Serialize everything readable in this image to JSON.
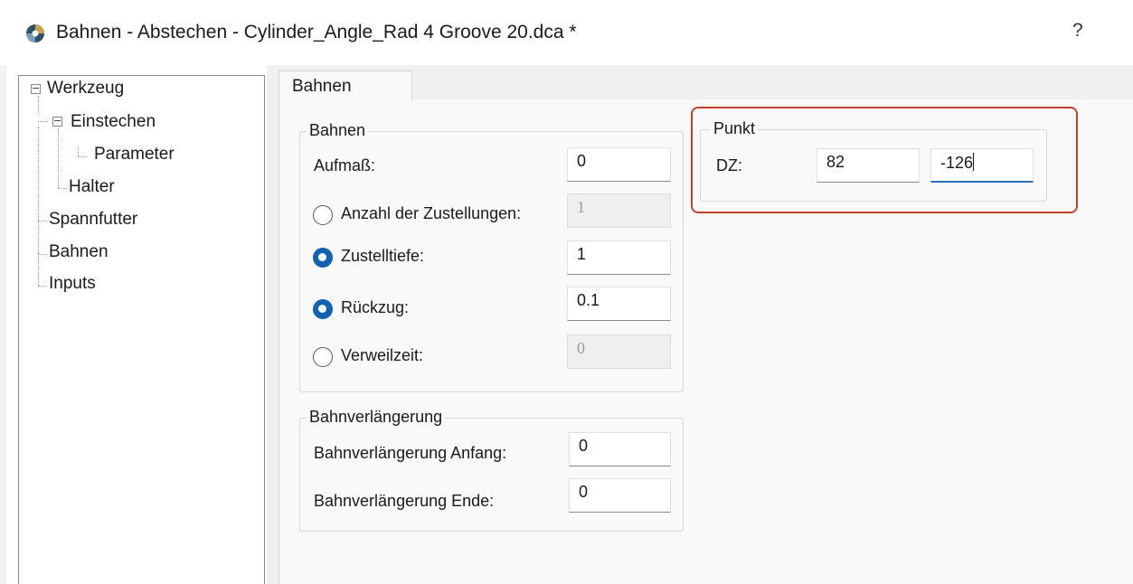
{
  "window": {
    "title": "Bahnen - Abstechen - Cylinder_Angle_Rad 4 Groove 20.dca *",
    "help_label": "?",
    "app_icon": "gear-app-icon"
  },
  "tree": {
    "items": [
      {
        "label": "Werkzeug",
        "expanded": true
      },
      {
        "label": "Einstechen",
        "expanded": true
      },
      {
        "label": "Parameter"
      },
      {
        "label": "Halter"
      },
      {
        "label": "Spannfutter"
      },
      {
        "label": "Bahnen"
      },
      {
        "label": "Inputs"
      }
    ],
    "expander_symbol": "−"
  },
  "tabs": [
    {
      "label": "Bahnen",
      "active": true
    }
  ],
  "bahnen_group": {
    "title": "Bahnen",
    "aufmass": {
      "label": "Aufmaß:",
      "value": "0"
    },
    "anzahl": {
      "label": "Anzahl der Zustellungen:",
      "value": "1",
      "selected": false,
      "enabled": false
    },
    "zustelltiefe": {
      "label": "Zustelltiefe:",
      "value": "1",
      "selected": true
    },
    "rueckzug": {
      "label": "Rückzug:",
      "value": "0.1",
      "selected": true
    },
    "verweilzeit": {
      "label": "Verweilzeit:",
      "value": "0",
      "selected": false,
      "enabled": false
    }
  },
  "bahnverlaengerung_group": {
    "title": "Bahnverlängerung",
    "anfang": {
      "label": "Bahnverlängerung Anfang:",
      "value": "0"
    },
    "ende": {
      "label": "Bahnverlängerung Ende:",
      "value": "0"
    }
  },
  "punkt_group": {
    "title": "Punkt",
    "dz_label": "DZ:",
    "dz_value_1": "82",
    "dz_value_2": "-126"
  },
  "colors": {
    "accent": "#0f62b6",
    "highlight_border": "#c0412e"
  }
}
